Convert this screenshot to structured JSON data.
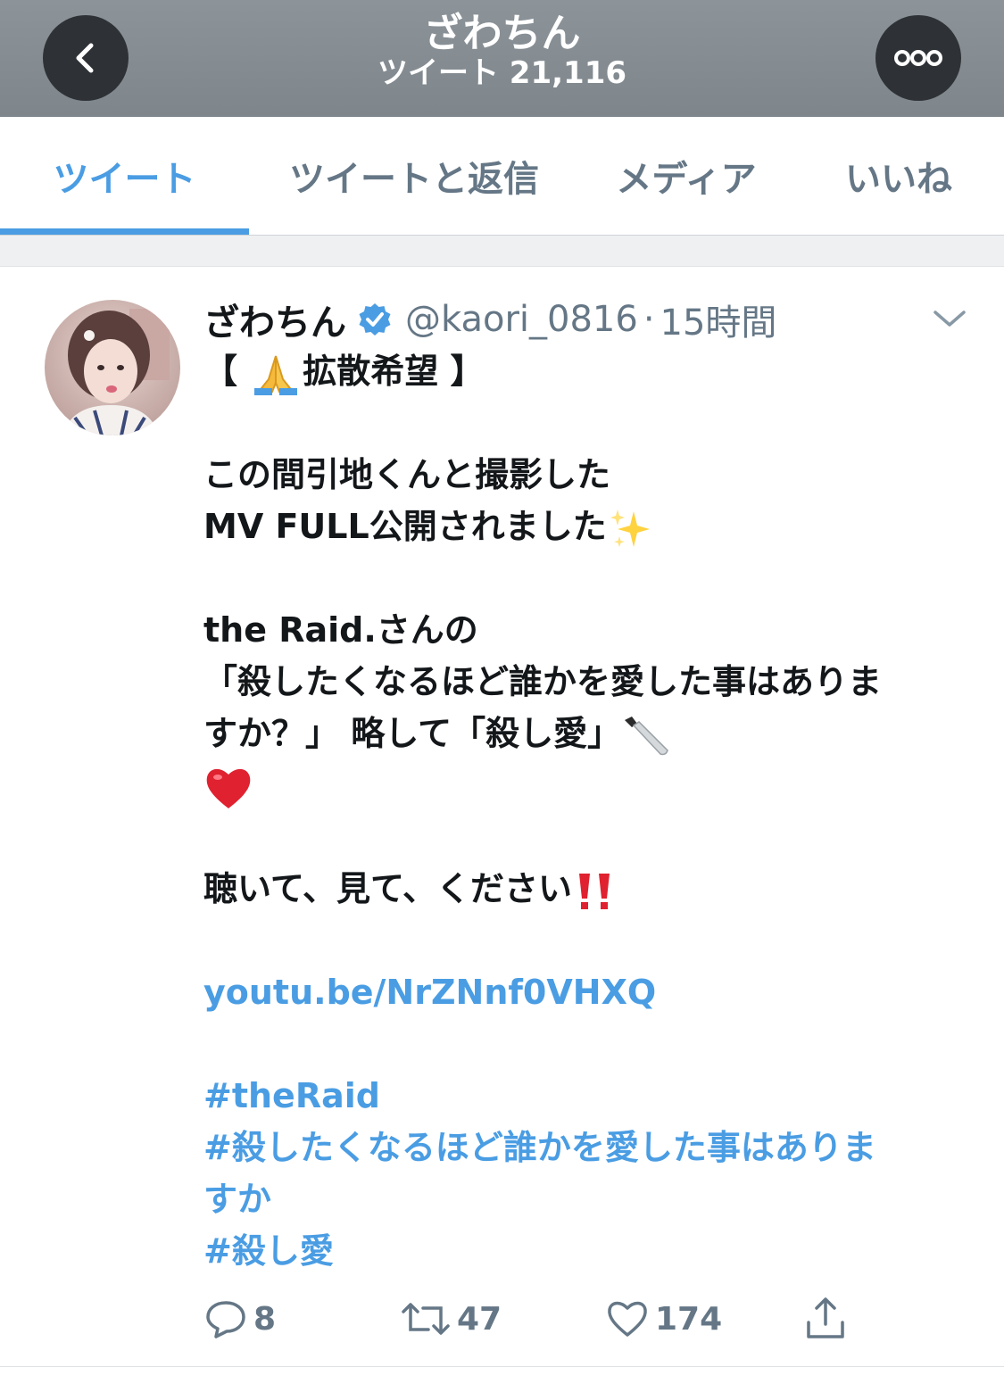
{
  "header": {
    "title": "ざわちん",
    "subtitle": "ツイート 21,116"
  },
  "tabs": [
    {
      "label": "ツイート",
      "active": true
    },
    {
      "label": "ツイートと返信",
      "active": false
    },
    {
      "label": "メディア",
      "active": false
    },
    {
      "label": "いいね",
      "active": false
    }
  ],
  "tweet": {
    "author_name": "ざわちん",
    "verified": true,
    "handle": "@kaori_0816",
    "separator": "·",
    "time": "15時間",
    "lines": {
      "l1_open": "【 ",
      "l1_text": "拡散希望 】",
      "l2": "この間引地くんと撮影した",
      "l3": "MV FULL公開されました",
      "l4": "the Raid.さんの",
      "l5": "「殺したくなるほど誰かを愛した事はありま",
      "l6": "すか？」 略して「殺し愛」",
      "l7": "聴いて、見て、ください",
      "link": "youtu.be/NrZNnf0VHXQ",
      "tag1": "#theRaid",
      "tag2a": "#殺したくなるほど誰かを愛した事はありま",
      "tag2b": "すか",
      "tag3": "#殺し愛"
    },
    "emojis": [
      "folded-hands",
      "sparkles",
      "kitchen-knife",
      "red-heart",
      "double-exclamation"
    ]
  },
  "actions": {
    "replies": "8",
    "retweets": "47",
    "likes": "174"
  },
  "colors": {
    "accent": "#4a9de3",
    "header_bg": "#848c92",
    "muted": "#657786",
    "text": "#14171a"
  }
}
